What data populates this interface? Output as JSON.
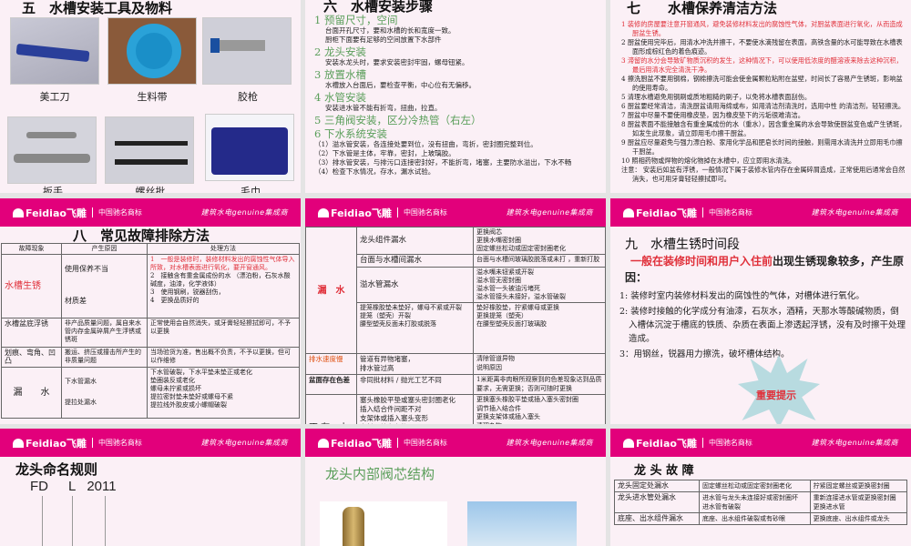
{
  "header": {
    "logo": "Feidiao飞雕",
    "brand": "中国驰名商标",
    "slogan": "建筑水电genuine集成商"
  },
  "slide5": {
    "title": "五　水槽安装工具及物料",
    "items": [
      "美工刀",
      "生料带",
      "胶枪",
      "扳手",
      "螺丝批",
      "毛巾"
    ]
  },
  "slide6": {
    "title": "六　水槽安装步骤",
    "steps": [
      {
        "h": "1  预留尺寸，空间",
        "b": [
          "台面开孔尺寸，要和水槽的长和宽度一致。",
          "厨柜下面要有足够的空间放置下水部件"
        ]
      },
      {
        "h": "2  龙头安装",
        "b": [
          "安装水龙头时，要求安装密封牢固，螺母钮紧。"
        ]
      },
      {
        "h": "3  放置水槽",
        "b": [
          "水槽放入台面后，要检查平衡，中心位有无偏移。"
        ]
      },
      {
        "h": "4  水管安装",
        "b": [
          "安装进水管不能有折弯，扭曲，拉直。"
        ]
      },
      {
        "h": "5  三角阀安装，区分冷热管（右左）",
        "b": []
      },
      {
        "h": "6  下水系统安装",
        "b": [
          "（1）溢水管安装，各连接处要到位，没有扭曲，弯折，密封圈完整到位。",
          "（2）下水管是主体，牢靠，密封，上玻璃胶。",
          "（3）排水管安装，与排污口连接密封好，不能折弯，堵塞，主要防水溢出，下水不畅",
          "（4）检查下水情况，存水，漏水试验。"
        ]
      }
    ]
  },
  "slide7": {
    "title": "七　　水槽保养清洁方法",
    "items": [
      {
        "n": "1",
        "t": "装修的房屋要注意开窗通风，避免装修材料发出的腐蚀性气体，对厨盆表面进行氧化，从而造成厨盆生锈。",
        "red": true
      },
      {
        "n": "2",
        "t": "厨盆使用完毕后，用清水冲洗并擦干，不要使水滴残留在表面，高铁含量的水可能导致在水槽表面形成棕红色的着色痕迹。"
      },
      {
        "n": "3",
        "t": "滞留的水分会导致矿物质沉积的发生，这种情况下，可以使用低浓度的醋溶液来除去这种沉积，最后用清水完全清洗干净。",
        "red": true
      },
      {
        "n": "4",
        "t": "擦洗厨盆不要用钢棉，钢棉擦洗可能会使金属颗粒粘附在盆壁，时间长了容易产生锈斑，影响盆的使用寿命。"
      },
      {
        "n": "5",
        "t": "清理水槽避免用钢刷或质地粗糙的刷子，以免将水槽表面刮伤。"
      },
      {
        "n": "6",
        "t": "厨盆要经常清洁，清洗厨盆请用海绵或布，如用清洁剂清洗时，选用中性 的清洁剂，轻轻擦洗。"
      },
      {
        "n": "7",
        "t": "厨盆中尽量不要使用橡皮垫，因为橡皮垫下的污垢很难清洁。"
      },
      {
        "n": "8",
        "t": "厨盆表面不能接触含有重金属成份的水（重水），因含重金属的水会导致使厨盆变色或产生锈斑，如发生此现象，请立即用毛巾擦干厨盆。"
      },
      {
        "n": "9",
        "t": "厨盆应尽量避免与强力漂白粉、家用化学品和肥皂长时间的接触，则需用水清洗并立即用毛巾擦干厨盆。"
      },
      {
        "n": "10",
        "t": "照相药物或焊物的熔化物掉在水槽中，应立即用水清洗。"
      },
      {
        "n": "注意：",
        "t": "安装后如盆有浮锈，一般情况下属于装修水管内存在金属碎屑造成，正常使用后通常会自然消失，也可用牙膏轻轻擦拭即可。"
      }
    ]
  },
  "slide8": {
    "title": "八　常见故障排除方法",
    "headers": [
      "故障现象",
      "产生原因",
      "处理方法"
    ],
    "r1": {
      "a": "水槽生锈",
      "b1": "使用保养不当",
      "b2": "材质差",
      "c": [
        "1　一般是装修时，装修材料发出的腐蚀性气体导入所致，对水槽表面进行氧化，要开窗通风。",
        "2　接触含有重金属成份的水 （漂泊粉，石灰水酸碱度，油漆，化学液体）",
        "3　使用钢刷，锐器刮伤，",
        "4　更换品质好的"
      ]
    },
    "r2": {
      "a": "水槽盆底浮锈",
      "b": "非产品质量问题，属自来水管内存金属碎屑产生浮锈或锈斑",
      "c": "正常使用会自然消失，或牙膏轻轻擦拭即可，不予以更换"
    },
    "r3": {
      "a": "划痕、弯角、凹凸",
      "b": "搬运、挤压或撞击所产生的非质量问题",
      "c": "当场验货为准，售出概不负责，不予以更换，但可以作维修"
    },
    "r4": {
      "a": "漏　　水",
      "b1": "下水管漏水",
      "b2": "提拉处漏水",
      "c": [
        "下水管破裂，下水平垫未垫正或老化",
        "垫圈装反或老化",
        "螺母未拧紧或损坏",
        "提拉密封垫未垫好或螺母不紧",
        "提拉线外胶皮或小螺帽破裂"
      ]
    }
  },
  "slide8b": {
    "leak": "漏　水",
    "rows": [
      {
        "b": "龙头组件漏水",
        "c": "更换阀芯\n更换水嘴密封圈\n固定螺丝松动或固定密封圈老化"
      },
      {
        "b": "台面与水槽间漏水",
        "c": "台面与水槽间玻璃胶脱落或未打 ，重新打胶"
      },
      {
        "b": "溢水管漏水",
        "c": "溢水嘴未钮紧或开裂\n溢水管无密封圈\n溢水管一头被油污堵死\n溢水管接头未接好，溢水管破裂"
      },
      {
        "b": "提笼橡胶垫未垫好，螺母不紧或开裂\n提笼（塑壳）开裂\n腰型塑壳反面未打胶或脱落",
        "c": "垫好橡胶垫，拧紧螺母或更换\n更换提笼（塑壳）\n在腰型塑壳反面打玻璃胶"
      }
    ],
    "slow": {
      "a": "排水速度慢",
      "b": "管道有异物堵塞，\n排水管过高",
      "c": "清除管道异物\n说明原因"
    },
    "color": {
      "a": "盆面存在色差",
      "b": "非同批材料 / 抛光工艺不同",
      "c": "1米距离非肉眼所观察到的色差现象达到品质要求，无需更换；否则可随时更换"
    },
    "nowater": {
      "a": "不 存　水",
      "b": "塞头橡胶平垫或塞头密封圈老化\n插入结合件间距不对\n支架体或插入塞头变形\n密封圈处有杂物",
      "c": "更换塞头橡胶平垫或插入塞头密封圈\n调节插入结合件\n更换支架体或插入塞头\n清理杂物"
    }
  },
  "slide9": {
    "title": "九　水槽生锈时间段",
    "lead_red": "一般在装修时间和用户入住前",
    "lead_rest": "出现生锈现象较多，产生原因：",
    "items": [
      "1:  装修时室内装修材料发出的腐蚀性的气体，对槽体进行氧化。",
      "2:  装修时接触的化学成分有油漆，石灰水，酒精，天那水等酸碱物质，倒入槽体沉淀于槽底的铁质、杂质在表面上渗透起浮锈，没有及时擦干处理造成。",
      "3：用钢丝，锐器用力擦洗，破坏槽体结构。"
    ],
    "badge": "重要提示"
  },
  "slide10": {
    "title": "龙头命名规则",
    "code": [
      "FD",
      "L",
      "2011"
    ]
  },
  "slide11": {
    "title": "龙头内部阀芯结构"
  },
  "slide12": {
    "title": "龙 头 故 障",
    "rows": [
      [
        "龙头固定处漏水",
        "固定螺丝松动或固定密封圈老化",
        "拧紧固定螺丝或更换密封圈"
      ],
      [
        "龙头进水管处漏水",
        "进水管与龙头未连接好或密封圈坏\n进水管有破裂",
        "重新连接进水管或更换密封圈\n更换进水管"
      ],
      [
        "底座、出水组件漏水",
        "底座、出水组件破裂或有砂眼",
        "更换底座、出水组件或龙头"
      ]
    ]
  },
  "colors": {
    "header": "#e2007b",
    "green": "#5a9e5a",
    "red": "#e0303a"
  }
}
